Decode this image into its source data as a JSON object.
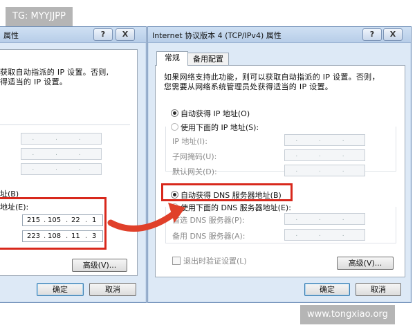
{
  "watermark_top": "TG: MYYJJPP",
  "watermark_bottom": "www.tongxiao.org",
  "left_dialog": {
    "title_fragment": "属性",
    "help": "?",
    "close": "X",
    "desc_line1": "获取自动指派的 IP 设置。否则,",
    "desc_line2": "得适当的 IP 设置。",
    "dns_auto_fragment": "址(B)",
    "dns_manual_fragment": "地址(E):",
    "dns1": [
      "215",
      "105",
      "22",
      "1"
    ],
    "dns2": [
      "223",
      "108",
      "11",
      "3"
    ],
    "advanced_button": "高级(V)...",
    "ok_button": "确定",
    "cancel_button": "取消"
  },
  "right_dialog": {
    "title": "Internet 协议版本 4 (TCP/IPv4) 属性",
    "help": "?",
    "close": "X",
    "tabs": [
      "常规",
      "备用配置"
    ],
    "desc_line1": "如果网络支持此功能，则可以获取自动指派的 IP 设置。否则，",
    "desc_line2": "您需要从网络系统管理员处获得适当的 IP 设置。",
    "ip_auto": "自动获得 IP 地址(O)",
    "ip_manual": "使用下面的 IP 地址(S):",
    "ip_address_label": "IP 地址(I):",
    "subnet_label": "子网掩码(U):",
    "gateway_label": "默认网关(D):",
    "dns_auto": "自动获得 DNS 服务器地址(B)",
    "dns_manual": "使用下面的 DNS 服务器地址(E):",
    "dns_primary_label": "首选 DNS 服务器(P):",
    "dns_alternate_label": "备用 DNS 服务器(A):",
    "validate_on_exit": "退出时验证设置(L)",
    "advanced_button": "高级(V)...",
    "ok_button": "确定",
    "cancel_button": "取消"
  },
  "colors": {
    "highlight_box": "#d8281c",
    "arrow": "#e0402a"
  }
}
